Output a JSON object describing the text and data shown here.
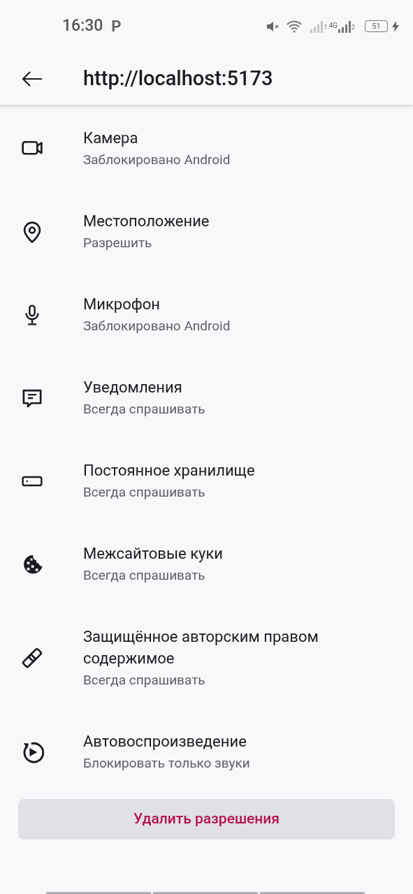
{
  "status_bar": {
    "time": "16:30",
    "notification_glyph": "P",
    "sim1_label": "1",
    "network_type": "4G",
    "sim2_label": "2",
    "battery": "51"
  },
  "header": {
    "title": "http://localhost:5173"
  },
  "permissions": [
    {
      "kind": "camera",
      "title": "Камера",
      "value": "Заблокировано Android"
    },
    {
      "kind": "location",
      "title": "Местоположение",
      "value": "Разрешить"
    },
    {
      "kind": "microphone",
      "title": "Микрофон",
      "value": "Заблокировано Android"
    },
    {
      "kind": "notifications",
      "title": "Уведомления",
      "value": "Всегда спрашивать"
    },
    {
      "kind": "storage",
      "title": "Постоянное хранилище",
      "value": "Всегда спрашивать"
    },
    {
      "kind": "cookie",
      "title": "Межсайтовые куки",
      "value": "Всегда спрашивать"
    },
    {
      "kind": "link",
      "title": "Защищённое авторским правом содержимое",
      "value": "Всегда спрашивать"
    },
    {
      "kind": "autoplay",
      "title": "Автовоспроизведение",
      "value": "Блокировать только звуки"
    }
  ],
  "clear_button": "Удалить разрешения"
}
